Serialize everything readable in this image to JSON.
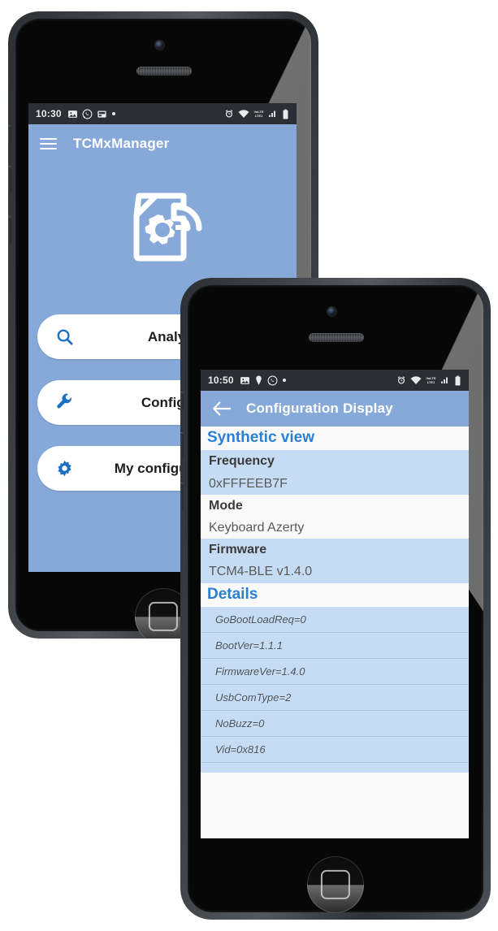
{
  "phone1": {
    "status_bar": {
      "time": "10:30",
      "left_icons": [
        "photo-icon",
        "whatsapp-icon",
        "inbox-icon",
        "dot-icon"
      ],
      "right_icons": [
        "alarm-icon",
        "wifi-icon",
        "volte-icon",
        "signal-icon",
        "battery-icon"
      ]
    },
    "appbar": {
      "menu_icon": "hamburger-icon",
      "title": "TCMxManager"
    },
    "logo": {
      "name": "tcmx-config-logo",
      "gear_icon": "gear-icon",
      "signal_icon": "wifi-arc-icon"
    },
    "menu": [
      {
        "icon": "search-icon",
        "label": "Analyze"
      },
      {
        "icon": "wrench-icon",
        "label": "Configure"
      },
      {
        "icon": "gear-icon",
        "label": "My configurations"
      }
    ]
  },
  "phone2": {
    "status_bar": {
      "time": "10:50",
      "left_icons": [
        "photo-icon",
        "location-icon",
        "whatsapp-icon",
        "dot-icon"
      ],
      "right_icons": [
        "alarm-icon",
        "wifi-icon",
        "volte-icon",
        "signal-icon",
        "battery-icon"
      ]
    },
    "appbar": {
      "back_icon": "back-arrow-icon",
      "title": "Configuration Display"
    },
    "synthetic_view": {
      "heading": "Synthetic view",
      "rows": [
        {
          "key": "Frequency",
          "value": "0xFFFEEB7F"
        },
        {
          "key": "Mode",
          "value": "Keyboard Azerty"
        },
        {
          "key": "Firmware",
          "value": "TCM4-BLE v1.4.0"
        }
      ]
    },
    "details": {
      "heading": "Details",
      "items": [
        "GoBootLoadReq=0",
        "BootVer=1.1.1",
        "FirmwareVer=1.4.0",
        "UsbComType=2",
        "NoBuzz=0",
        "Vid=0x816"
      ]
    }
  },
  "colors": {
    "brand_blue": "#87a9d9",
    "row_blue": "#c6dcf4",
    "row_white": "#fafafa",
    "section_heading": "#2a7fd4",
    "status_bar": "#2b2f35"
  }
}
